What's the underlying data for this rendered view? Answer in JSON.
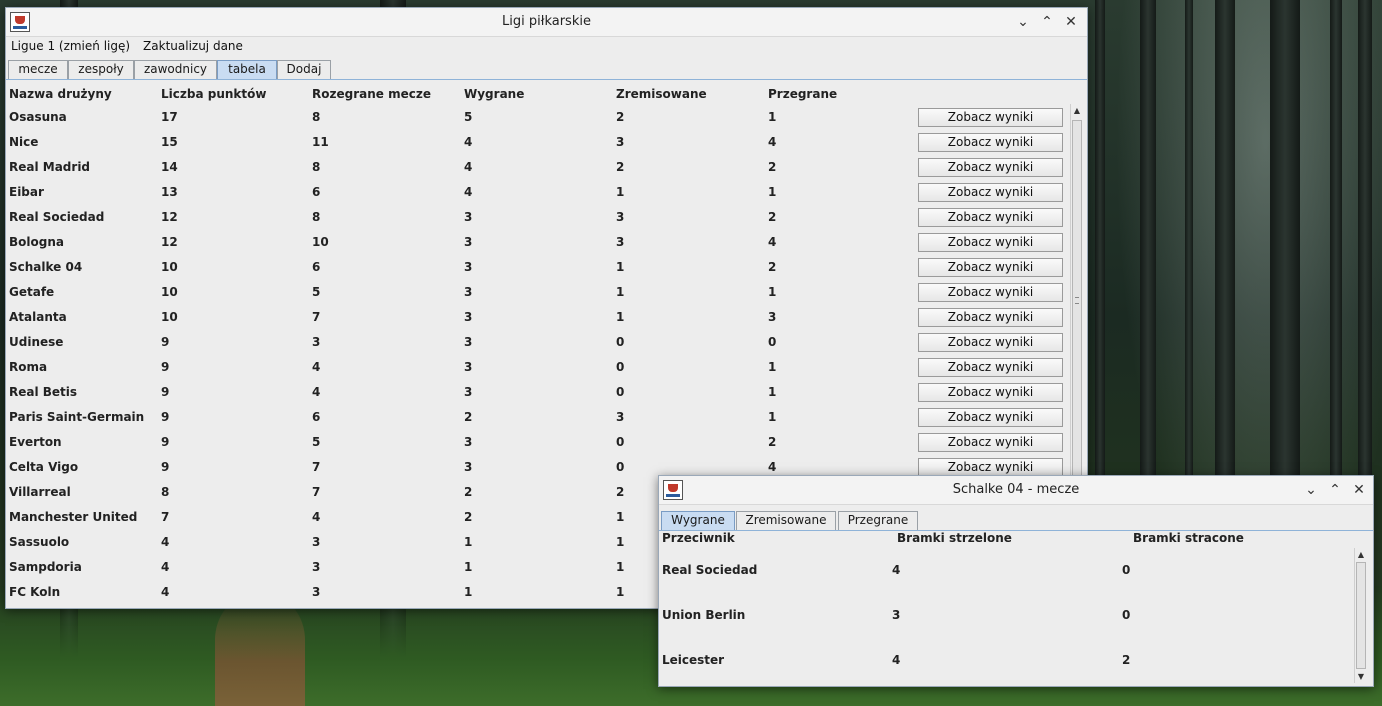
{
  "main": {
    "title": "Ligi piłkarskie",
    "menu": [
      "Ligue 1 (zmień ligę)",
      "Zaktualizuj dane"
    ],
    "tabs": [
      "mecze",
      "zespoły",
      "zawodnicy",
      "tabela",
      "Dodaj"
    ],
    "active_tab": "tabela",
    "columns": [
      "Nazwa drużyny",
      "Liczba punktów",
      "Rozegrane mecze",
      "Wygrane",
      "Zremisowane",
      "Przegrane"
    ],
    "button_label": "Zobacz wyniki",
    "rows": [
      [
        "Osasuna",
        "17",
        "8",
        "5",
        "2",
        "1"
      ],
      [
        "Nice",
        "15",
        "11",
        "4",
        "3",
        "4"
      ],
      [
        "Real Madrid",
        "14",
        "8",
        "4",
        "2",
        "2"
      ],
      [
        "Eibar",
        "13",
        "6",
        "4",
        "1",
        "1"
      ],
      [
        "Real Sociedad",
        "12",
        "8",
        "3",
        "3",
        "2"
      ],
      [
        "Bologna",
        "12",
        "10",
        "3",
        "3",
        "4"
      ],
      [
        "Schalke 04",
        "10",
        "6",
        "3",
        "1",
        "2"
      ],
      [
        "Getafe",
        "10",
        "5",
        "3",
        "1",
        "1"
      ],
      [
        "Atalanta",
        "10",
        "7",
        "3",
        "1",
        "3"
      ],
      [
        "Udinese",
        "9",
        "3",
        "3",
        "0",
        "0"
      ],
      [
        "Roma",
        "9",
        "4",
        "3",
        "0",
        "1"
      ],
      [
        "Real Betis",
        "9",
        "4",
        "3",
        "0",
        "1"
      ],
      [
        "Paris Saint-Germain",
        "9",
        "6",
        "2",
        "3",
        "1"
      ],
      [
        "Everton",
        "9",
        "5",
        "3",
        "0",
        "2"
      ],
      [
        "Celta Vigo",
        "9",
        "7",
        "3",
        "0",
        "4"
      ],
      [
        "Villarreal",
        "8",
        "7",
        "2",
        "2",
        ""
      ],
      [
        "Manchester United",
        "7",
        "4",
        "2",
        "1",
        ""
      ],
      [
        "Sassuolo",
        "4",
        "3",
        "1",
        "1",
        ""
      ],
      [
        "Sampdoria",
        "4",
        "3",
        "1",
        "1",
        ""
      ],
      [
        "FC Koln",
        "4",
        "3",
        "1",
        "1",
        ""
      ]
    ],
    "buttons_visible": 15
  },
  "popup": {
    "title": "Schalke 04 - mecze",
    "tabs": [
      "Wygrane",
      "Zremisowane",
      "Przegrane"
    ],
    "active_tab": "Wygrane",
    "columns": [
      "Przeciwnik",
      "Bramki strzelone",
      "Bramki stracone"
    ],
    "rows": [
      [
        "Real Sociedad",
        "4",
        "0"
      ],
      [
        "Union Berlin",
        "3",
        "0"
      ],
      [
        "Leicester",
        "4",
        "2"
      ]
    ]
  },
  "icons": {
    "minimize": "chevron-down-icon",
    "maximize": "chevron-up-icon",
    "close": "close-icon",
    "scroll_up": "arrow-up-icon",
    "scroll_down": "arrow-down-icon"
  },
  "colors": {
    "active_tab": "#c9dcf2",
    "window_bg": "#ededed",
    "window_border": "#9aa8b8"
  }
}
